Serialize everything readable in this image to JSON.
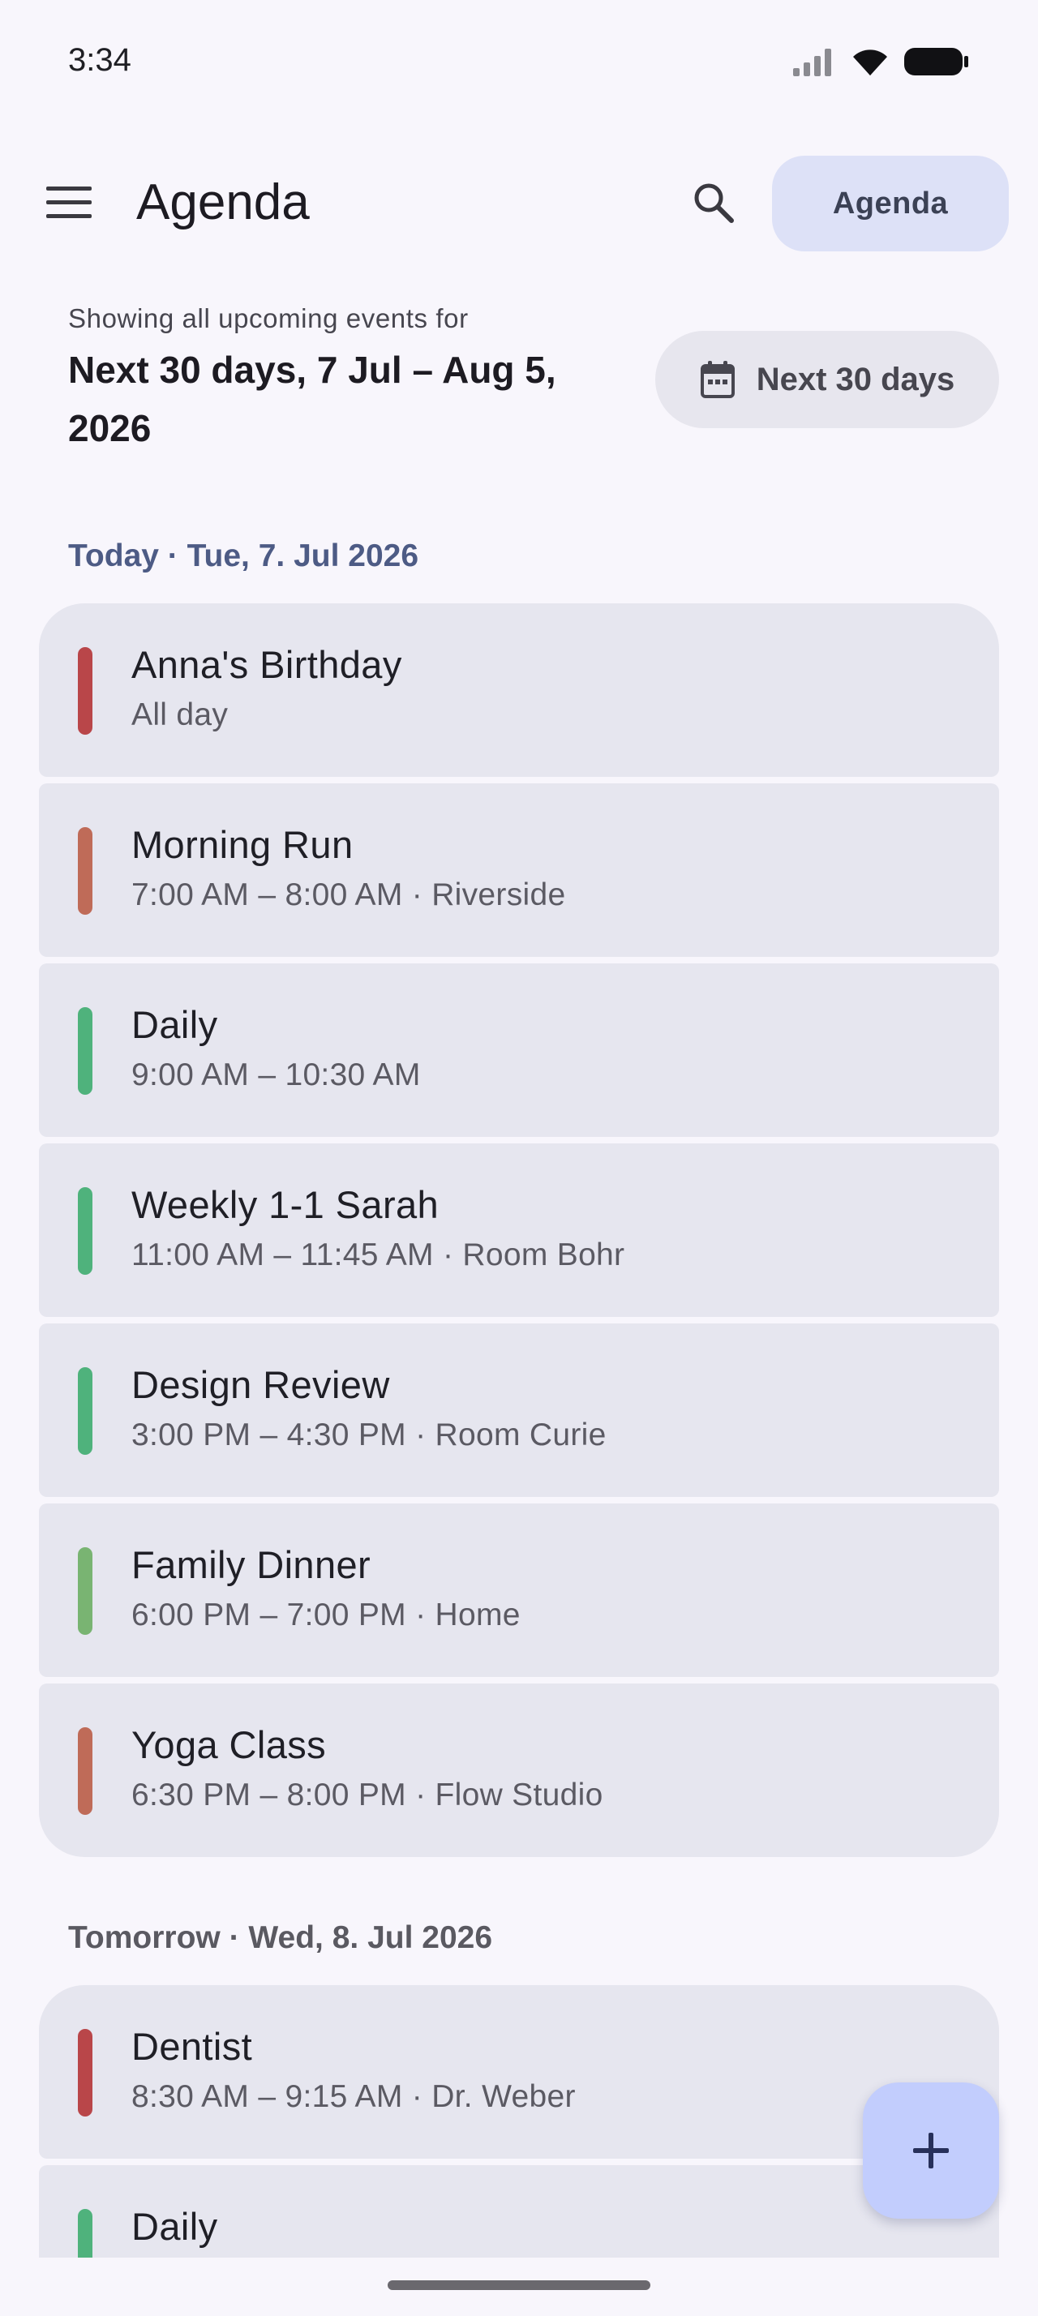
{
  "status_bar": {
    "time": "3:34"
  },
  "app_bar": {
    "title": "Agenda",
    "menu_icon": "menu-icon",
    "search_icon": "search-icon",
    "view_chip_label": "Agenda"
  },
  "range": {
    "caption": "Showing all upcoming events for",
    "title": "Next 30 days, 7 Jul – Aug 5, 2026",
    "button_label": "Next 30 days",
    "button_icon": "calendar-icon"
  },
  "days": [
    {
      "header": "Today · Tue, 7. Jul 2026",
      "events": [
        {
          "title": "Anna's Birthday",
          "subtitle": "All day",
          "color": "#b94649"
        },
        {
          "title": "Morning Run",
          "subtitle": "7:00 AM – 8:00 AM · Riverside",
          "color": "#bf6b58"
        },
        {
          "title": "Daily",
          "subtitle": "9:00 AM – 10:30 AM",
          "color": "#4fb27c"
        },
        {
          "title": "Weekly 1-1 Sarah",
          "subtitle": "11:00 AM – 11:45 AM · Room Bohr",
          "color": "#4fb27c"
        },
        {
          "title": "Design Review",
          "subtitle": "3:00 PM – 4:30 PM · Room Curie",
          "color": "#4fb27c"
        },
        {
          "title": "Family Dinner",
          "subtitle": "6:00 PM – 7:00 PM · Home",
          "color": "#79b472"
        },
        {
          "title": "Yoga Class",
          "subtitle": "6:30 PM – 8:00 PM · Flow Studio",
          "color": "#bf6b58"
        }
      ]
    },
    {
      "header": "Tomorrow · Wed, 8. Jul 2026",
      "events": [
        {
          "title": "Dentist",
          "subtitle": "8:30 AM – 9:15 AM · Dr. Weber",
          "color": "#b94649"
        },
        {
          "title": "Daily",
          "subtitle": "",
          "color": "#4fb27c"
        }
      ]
    }
  ],
  "fab": {
    "icon": "add-icon"
  },
  "colors": {
    "background": "#f8f6fc",
    "card": "#e6e6ef",
    "chip": "#dde1f7",
    "fab": "#c2cdfd",
    "today_header": "#4d5b85"
  }
}
